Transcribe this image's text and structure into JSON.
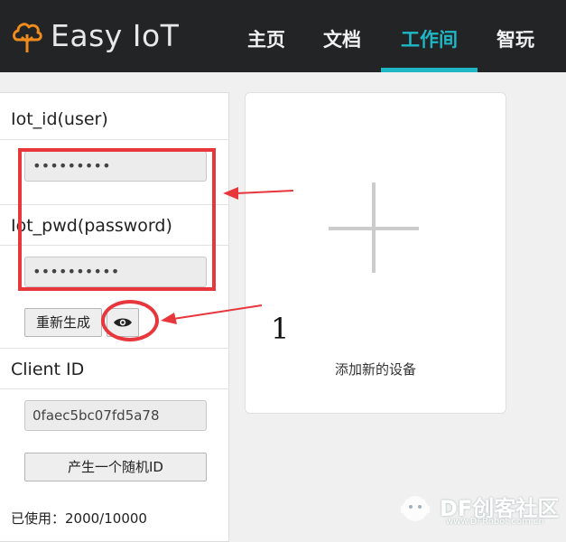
{
  "brand": {
    "name": "Easy IoT"
  },
  "nav": {
    "items": [
      {
        "label": "主页"
      },
      {
        "label": "文档"
      },
      {
        "label": "工作间"
      },
      {
        "label": "智玩"
      }
    ],
    "active_index": 2,
    "accent_color": "#1fb7c5"
  },
  "panel": {
    "iot_id_label": "Iot_id(user)",
    "iot_id_value": "•••••••••",
    "iot_pwd_label": "Iot_pwd(password)",
    "iot_pwd_value": "••••••••••",
    "regenerate_label": "重新生成",
    "eye_icon": "eye-icon",
    "client_id_label": "Client ID",
    "client_id_value": "0faec5bc07fd5a78",
    "random_id_label": "产生一个随机ID",
    "usage_text": "已使用：2000/10000"
  },
  "add_device": {
    "icon": "plus-icon",
    "label": "添加新的设备"
  },
  "annotation": {
    "number": "1",
    "color": "#e8373c"
  },
  "watermark": {
    "text": "DF创客社区",
    "url": "www.DFRobot.com.cn"
  }
}
